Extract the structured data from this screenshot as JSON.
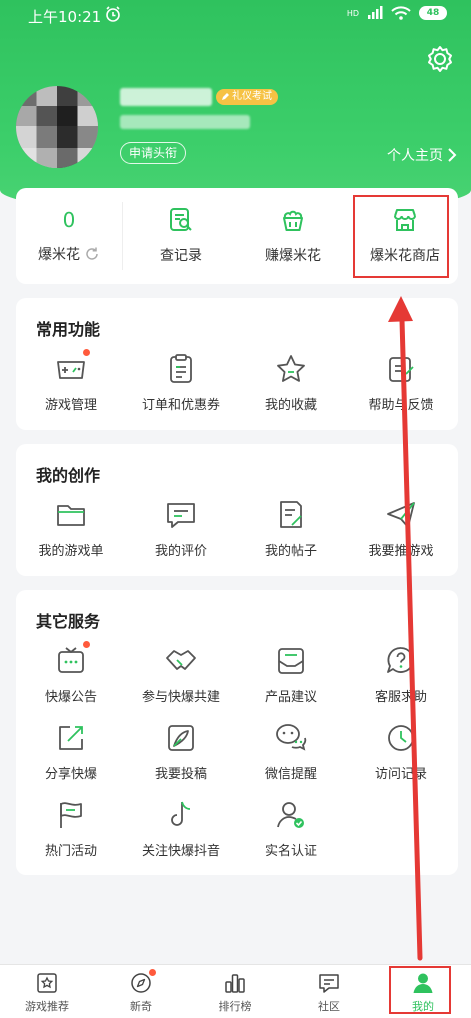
{
  "status_bar": {
    "time": "上午10:21",
    "network": "HD",
    "battery": "48"
  },
  "profile": {
    "badge": "礼仪考试",
    "apply_title": "申请头衔",
    "home_link": "个人主页"
  },
  "top_card": {
    "popcorn_count": "0",
    "popcorn_label": "爆米花",
    "items": [
      {
        "label": "查记录"
      },
      {
        "label": "赚爆米花"
      },
      {
        "label": "爆米花商店"
      }
    ]
  },
  "common": {
    "title": "常用功能",
    "items": [
      {
        "label": "游戏管理"
      },
      {
        "label": "订单和优惠券"
      },
      {
        "label": "我的收藏"
      },
      {
        "label": "帮助与反馈"
      }
    ]
  },
  "creation": {
    "title": "我的创作",
    "items": [
      {
        "label": "我的游戏单"
      },
      {
        "label": "我的评价"
      },
      {
        "label": "我的帖子"
      },
      {
        "label": "我要推游戏"
      }
    ]
  },
  "other": {
    "title": "其它服务",
    "items": [
      {
        "label": "快爆公告"
      },
      {
        "label": "参与快爆共建"
      },
      {
        "label": "产品建议"
      },
      {
        "label": "客服求助"
      },
      {
        "label": "分享快爆"
      },
      {
        "label": "我要投稿"
      },
      {
        "label": "微信提醒"
      },
      {
        "label": "访问记录"
      },
      {
        "label": "热门活动"
      },
      {
        "label": "关注快爆抖音"
      },
      {
        "label": "实名认证"
      }
    ]
  },
  "bottom_nav": {
    "items": [
      {
        "label": "游戏推荐"
      },
      {
        "label": "新奇"
      },
      {
        "label": "排行榜"
      },
      {
        "label": "社区"
      },
      {
        "label": "我的"
      }
    ]
  },
  "colors": {
    "accent": "#2fc25e",
    "annotation": "#e53935",
    "dot": "#ff5a3c"
  }
}
